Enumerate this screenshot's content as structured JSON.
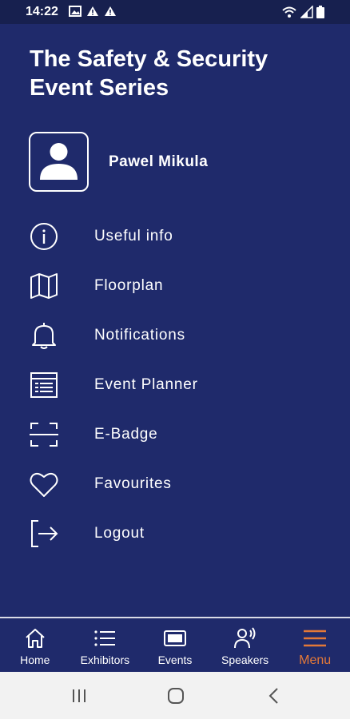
{
  "status_bar": {
    "time": "14:22",
    "left_icons": [
      "image-icon",
      "warning-icon",
      "warning-icon"
    ],
    "right_icons": [
      "wifi-icon",
      "signal-icon",
      "battery-icon"
    ]
  },
  "app": {
    "title": "The Safety & Security Event Series"
  },
  "profile": {
    "name": "Pawel Mikula",
    "avatar_icon": "user-icon"
  },
  "menu": {
    "items": [
      {
        "label": "Useful info",
        "icon": "info-icon"
      },
      {
        "label": "Floorplan",
        "icon": "map-icon"
      },
      {
        "label": "Notifications",
        "icon": "bell-icon"
      },
      {
        "label": "Event Planner",
        "icon": "planner-icon"
      },
      {
        "label": "E-Badge",
        "icon": "scan-icon"
      },
      {
        "label": "Favourites",
        "icon": "heart-icon"
      },
      {
        "label": "Logout",
        "icon": "logout-icon"
      }
    ]
  },
  "bottom_nav": {
    "items": [
      {
        "label": "Home",
        "icon": "home-icon"
      },
      {
        "label": "Exhibitors",
        "icon": "list-icon"
      },
      {
        "label": "Events",
        "icon": "events-icon"
      },
      {
        "label": "Speakers",
        "icon": "speaker-icon"
      },
      {
        "label": "Menu",
        "icon": "menu-icon",
        "active": true
      }
    ]
  },
  "system_nav": {
    "buttons": [
      "recents-icon",
      "home-circle-icon",
      "back-icon"
    ]
  },
  "colors": {
    "background": "#1f2a6b",
    "status_bar": "#17204f",
    "active": "#e37838",
    "text": "#ffffff",
    "system_nav": "#f2f2f2"
  }
}
